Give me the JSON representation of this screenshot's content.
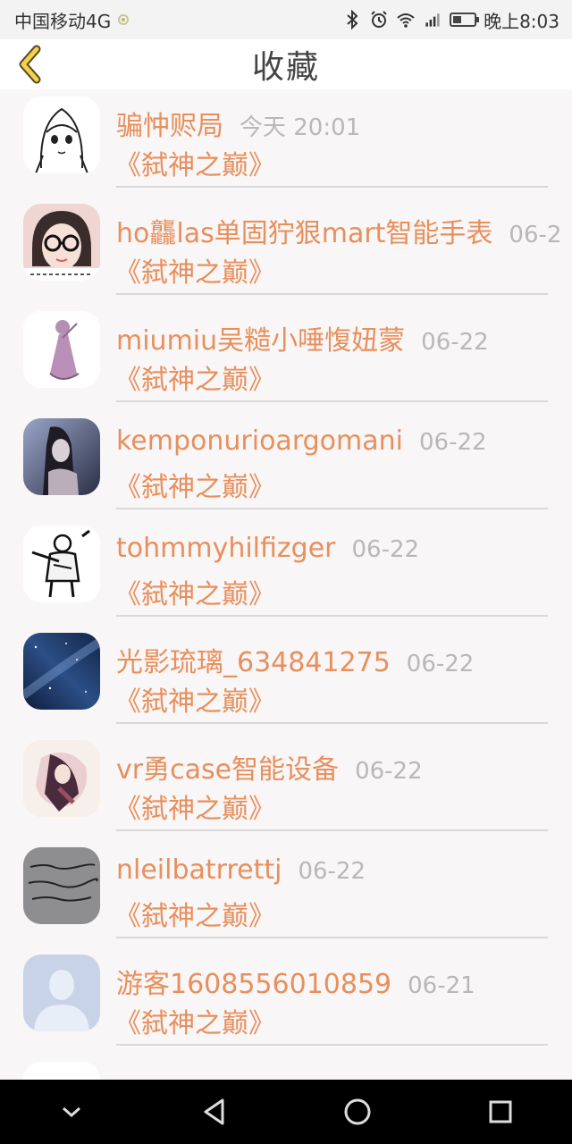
{
  "status_bar": {
    "carrier": "中国移动4G",
    "time": "晚上8:03"
  },
  "header": {
    "title": "收藏",
    "back_icon": "chevron-left-icon",
    "accent": "#e6c54a"
  },
  "items": [
    {
      "name": "骗忡赆局",
      "time": "今天 20:01",
      "book": "《弑神之巅》",
      "avatar": "anime-girl-sketch"
    },
    {
      "name": "ho龘las单固狞狠mart智能手表",
      "time": "06-2",
      "book": "《弑神之巅》",
      "avatar": "girl-with-glasses"
    },
    {
      "name": "miumiu吴糙小唾愎妞蒙",
      "time": "06-22",
      "book": "《弑神之巅》",
      "avatar": "pink-dress-figure"
    },
    {
      "name": "kemponurioargomani",
      "time": "06-22",
      "book": "《弑神之巅》",
      "avatar": "dark-portrait"
    },
    {
      "name": "tohmmyhilfizger",
      "time": "06-22",
      "book": "《弑神之巅》",
      "avatar": "ink-warrior-drawing"
    },
    {
      "name": "光影琉璃_634841275",
      "time": "06-22",
      "book": "《弑神之巅》",
      "avatar": "starry-sky"
    },
    {
      "name": "vr勇case智能设备",
      "time": "06-22",
      "book": "《弑神之巅》",
      "avatar": "anime-illustration"
    },
    {
      "name": "nleilbatrrettj",
      "time": "06-22",
      "book": "《弑神之巅》",
      "avatar": "handwriting-photo"
    },
    {
      "name": "游客1608556010859",
      "time": "06-21",
      "book": "《弑神之巅》",
      "avatar": "default-user-silhouette"
    }
  ],
  "colors": {
    "name": "#e88f5c",
    "time": "#b8b8b8",
    "background": "#f8f6f6"
  },
  "nav": {
    "icons": [
      "chevron-down-icon",
      "back-triangle-icon",
      "home-circle-icon",
      "recents-square-icon"
    ]
  }
}
